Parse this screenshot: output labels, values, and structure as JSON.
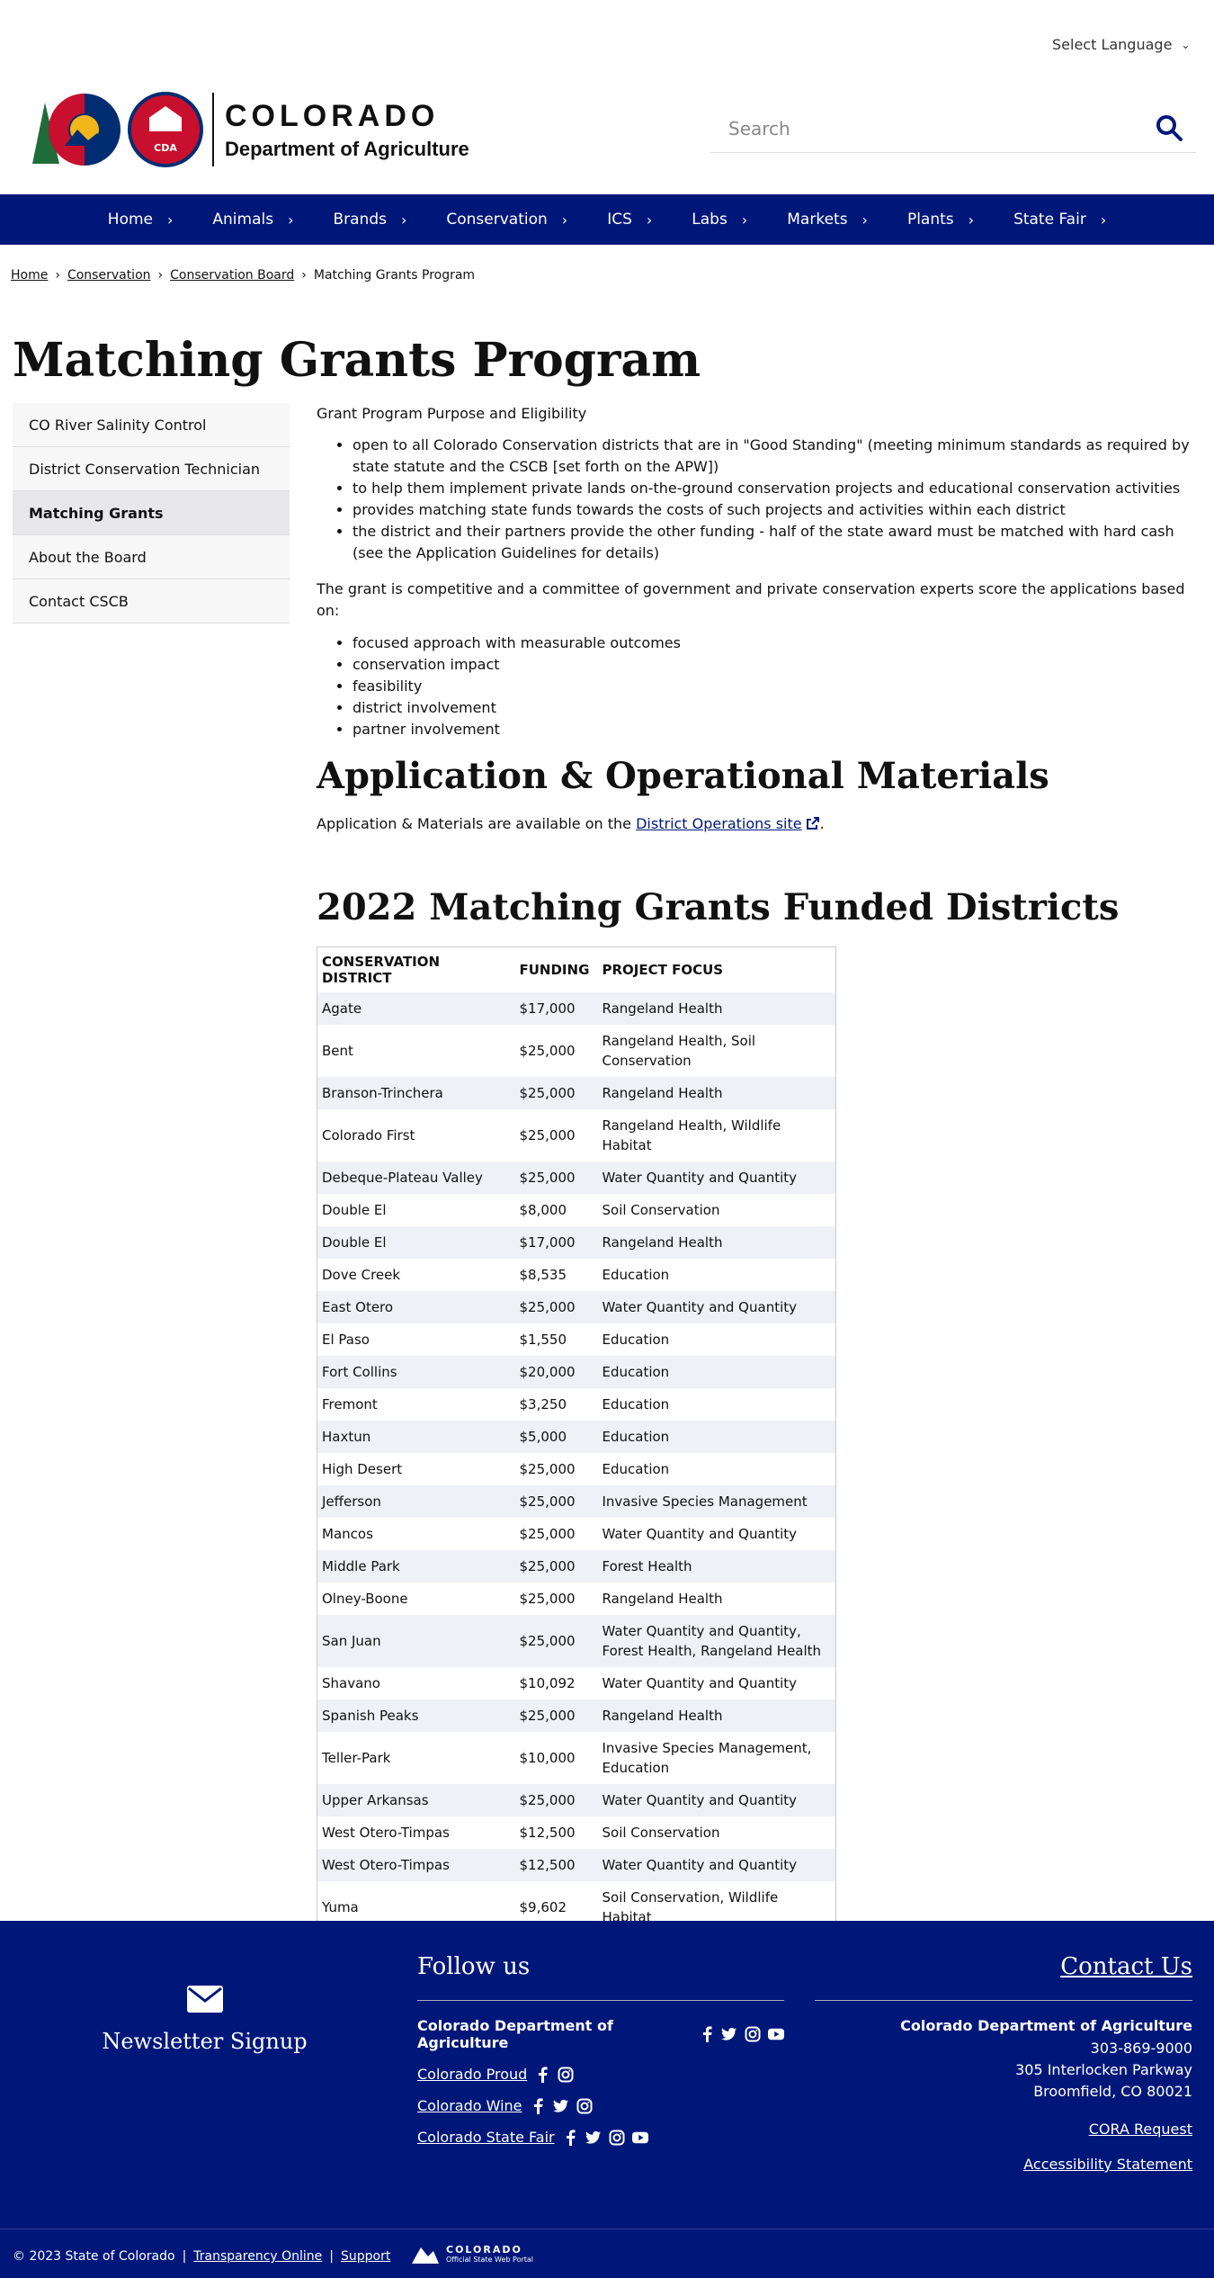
{
  "header": {
    "language_label": "Select Language",
    "logo_line1": "COLORADO",
    "logo_line2": "Department of Agriculture",
    "logo_badge": "CDA",
    "search_placeholder": "Search"
  },
  "nav": [
    "Home",
    "Animals",
    "Brands",
    "Conservation",
    "ICS",
    "Labs",
    "Markets",
    "Plants",
    "State Fair"
  ],
  "breadcrumb": {
    "items": [
      "Home",
      "Conservation",
      "Conservation Board"
    ],
    "current": "Matching Grants Program"
  },
  "page_title": "Matching Grants Program",
  "sidebar": [
    {
      "label": "CO River Salinity Control",
      "active": false
    },
    {
      "label": "District Conservation Technician",
      "active": false
    },
    {
      "label": "Matching Grants",
      "active": true
    },
    {
      "label": "About the Board",
      "active": false
    },
    {
      "label": "Contact CSCB",
      "active": false
    }
  ],
  "main": {
    "intro": "Grant Program Purpose and Eligibility",
    "bullets1": [
      "open to all Colorado Conservation districts that are in \"Good Standing\" (meeting minimum standards as required by state statute and the CSCB [set forth on the APW])",
      "to help them implement private lands on-the-ground conservation projects and educational conservation activities",
      "provides matching state funds towards the costs of such projects and activities within each district",
      "the district and their partners provide the other funding - half of the state award must be matched with hard cash (see the Application Guidelines for details)"
    ],
    "para": "The grant is competitive and a committee of government and private conservation experts score the applications based on:",
    "bullets2": [
      "focused approach with measurable outcomes",
      "conservation impact",
      "feasibility",
      "district involvement",
      "partner involvement"
    ],
    "app_heading": "Application & Operational Materials",
    "avail_text": "Application & Materials are available on the",
    "avail_link": "District Operations site",
    "avail_end": ".",
    "funded_heading": "2022 Matching Grants Funded Districts",
    "table_headers": [
      "CONSERVATION DISTRICT",
      "FUNDING",
      "PROJECT FOCUS"
    ],
    "table_rows": [
      [
        "Agate",
        "$17,000",
        "Rangeland Health"
      ],
      [
        "Bent",
        "$25,000",
        "Rangeland Health, Soil Conservation"
      ],
      [
        "Branson-Trinchera",
        "$25,000",
        "Rangeland Health"
      ],
      [
        "Colorado First",
        "$25,000",
        "Rangeland Health, Wildlife Habitat"
      ],
      [
        "Debeque-Plateau Valley",
        "$25,000",
        "Water Quantity and Quantity"
      ],
      [
        "Double El",
        "$8,000",
        "Soil Conservation"
      ],
      [
        "Double El",
        "$17,000",
        "Rangeland Health"
      ],
      [
        "Dove Creek",
        "$8,535",
        "Education"
      ],
      [
        "East Otero",
        "$25,000",
        "Water Quantity and Quantity"
      ],
      [
        "El Paso",
        "$1,550",
        "Education"
      ],
      [
        "Fort Collins",
        "$20,000",
        "Education"
      ],
      [
        "Fremont",
        "$3,250",
        "Education"
      ],
      [
        "Haxtun",
        "$5,000",
        "Education"
      ],
      [
        "High Desert",
        "$25,000",
        "Education"
      ],
      [
        "Jefferson",
        "$25,000",
        "Invasive Species Management"
      ],
      [
        "Mancos",
        "$25,000",
        "Water Quantity and Quantity"
      ],
      [
        "Middle Park",
        "$25,000",
        "Forest Health"
      ],
      [
        "Olney-Boone",
        "$25,000",
        "Rangeland Health"
      ],
      [
        "San Juan",
        "$25,000",
        "Water Quantity and Quantity, Forest Health, Rangeland Health"
      ],
      [
        "Shavano",
        "$10,092",
        "Water Quantity and Quantity"
      ],
      [
        "Spanish Peaks",
        "$25,000",
        "Rangeland Health"
      ],
      [
        "Teller-Park",
        "$10,000",
        "Invasive Species Management, Education"
      ],
      [
        "Upper Arkansas",
        "$25,000",
        "Water Quantity and Quantity"
      ],
      [
        "West Otero-Timpas",
        "$12,500",
        "Soil Conservation"
      ],
      [
        "West Otero-Timpas",
        "$12,500",
        "Water Quantity and Quantity"
      ],
      [
        "Yuma",
        "$9,602",
        "Soil Conservation, Wildlife Habitat"
      ]
    ]
  },
  "footer": {
    "newsletter": "Newsletter Signup",
    "follow_heading": "Follow us",
    "follow_rows": [
      {
        "label": "Colorado Department of Agriculture",
        "icons": [
          "facebook-icon",
          "twitter-icon",
          "instagram-icon",
          "youtube-icon"
        ],
        "link": false
      },
      {
        "label": "Colorado Proud",
        "icons": [
          "facebook-icon",
          "instagram-icon"
        ],
        "link": true
      },
      {
        "label": "Colorado Wine",
        "icons": [
          "facebook-icon",
          "twitter-icon",
          "instagram-icon"
        ],
        "link": true
      },
      {
        "label": "Colorado State Fair",
        "icons": [
          "facebook-icon",
          "twitter-icon",
          "instagram-icon",
          "youtube-icon"
        ],
        "link": true
      }
    ],
    "contact_heading": "Contact Us",
    "org": "Colorado Department of Agriculture",
    "phone": "303-869-9000",
    "address1": "305 Interlocken Parkway",
    "address2": "Broomfield, CO 80021",
    "cora": "CORA Request",
    "accessibility": "Accessibility Statement"
  },
  "bottom": {
    "copyright": "© 2023 State of Colorado",
    "sep": "|",
    "transparency": "Transparency Online",
    "support": "Support",
    "portal1": "COLORADO",
    "portal2": "Official State Web Portal"
  },
  "colors": {
    "nav_bg": "#00177a",
    "accent_red": "#c8102e",
    "accent_yellow": "#f2b61b",
    "table_stripe": "#eef1f6"
  }
}
